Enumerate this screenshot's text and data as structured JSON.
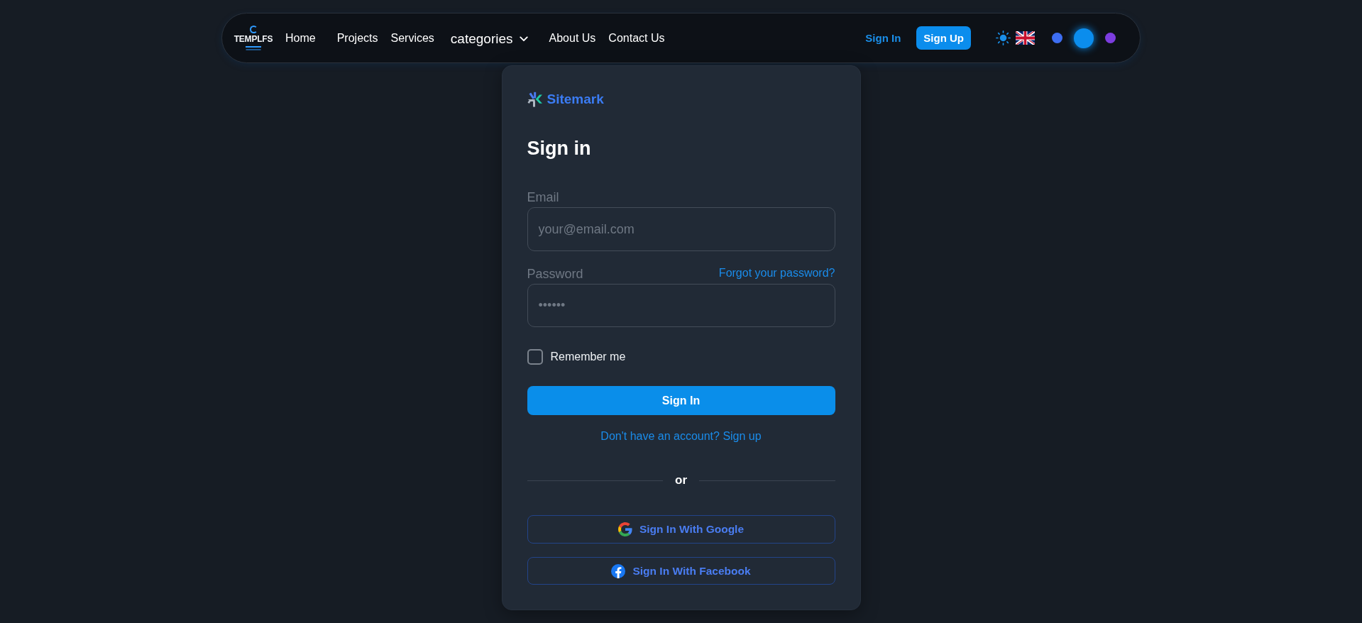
{
  "navbar": {
    "logo": "TEMPLFS",
    "links": [
      {
        "label": "Home",
        "kind": "link"
      },
      {
        "label": "Projects",
        "kind": "link"
      },
      {
        "label": "Services",
        "kind": "link"
      },
      {
        "label": "categories",
        "kind": "dropdown"
      },
      {
        "label": "About Us",
        "kind": "link"
      },
      {
        "label": "Contact Us",
        "kind": "link"
      }
    ],
    "sign_in": "Sign In",
    "sign_up": "Sign Up",
    "theme_colors": [
      {
        "color": "#3d6ef2",
        "selected": false
      },
      {
        "color": "#0b8ded",
        "selected": true
      },
      {
        "color": "#7c3ddf",
        "selected": false
      }
    ]
  },
  "card": {
    "brand": "Sitemark",
    "title": "Sign in",
    "email": {
      "label": "Email",
      "placeholder": "your@email.com"
    },
    "password": {
      "label": "Password",
      "placeholder": "••••••",
      "forgot": "Forgot your password?"
    },
    "remember_me": {
      "label": "Remember me",
      "checked": false
    },
    "submit": "Sign In",
    "signup_prompt": "Don't have an account? Sign up",
    "divider": "or",
    "social": [
      {
        "label": "Sign In With Google",
        "kind": "google"
      },
      {
        "label": "Sign In With Facebook",
        "kind": "facebook"
      }
    ]
  }
}
